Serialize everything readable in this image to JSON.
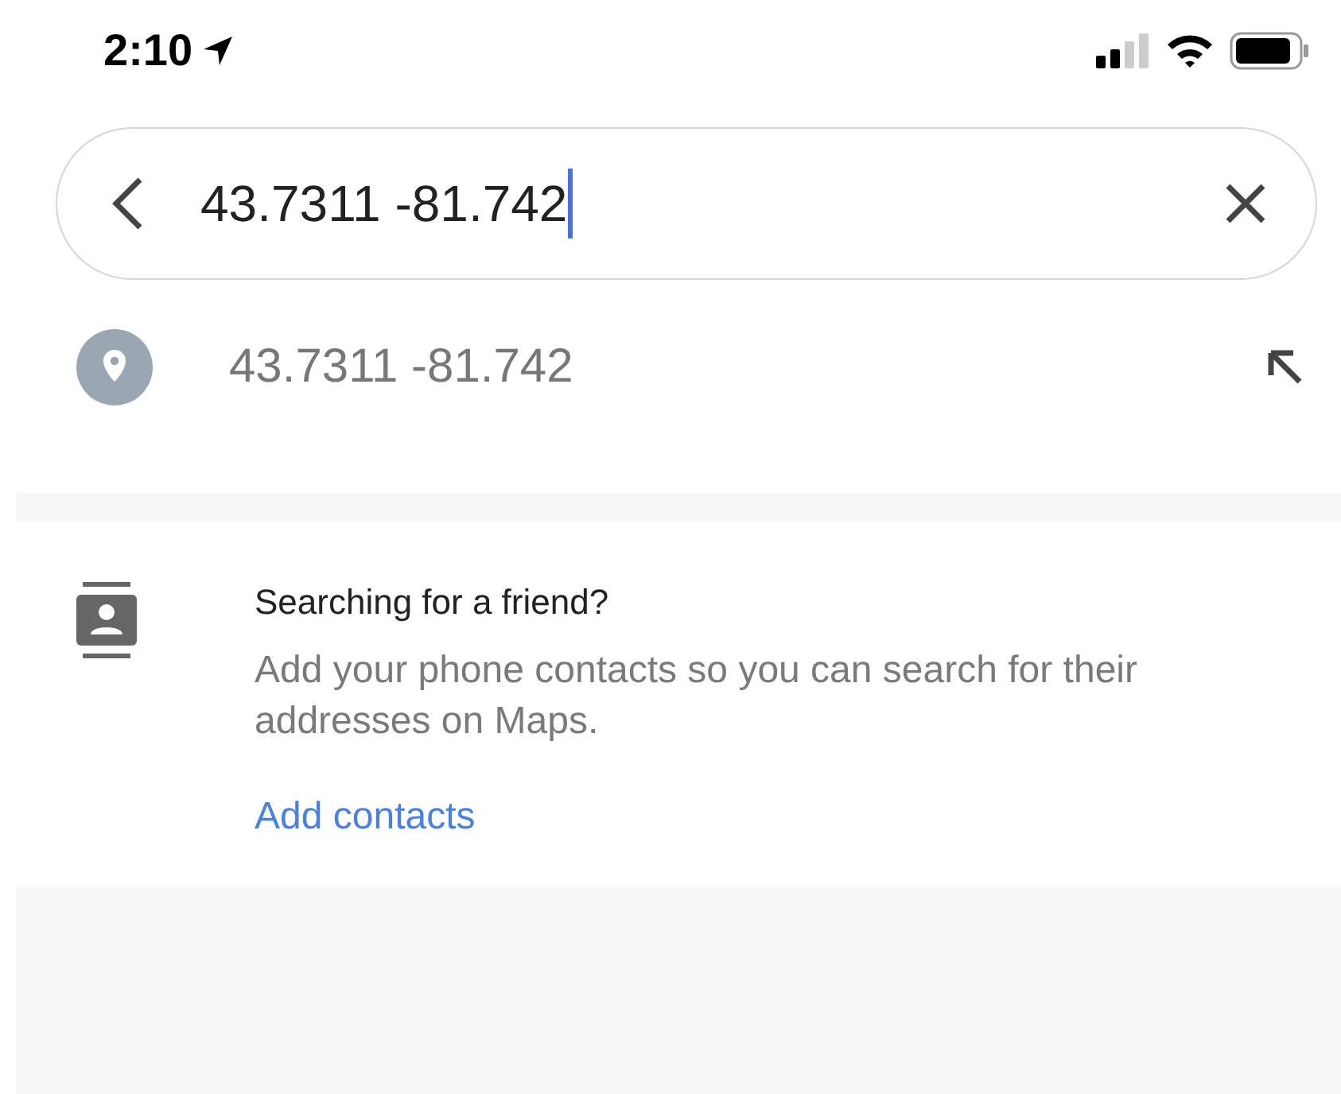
{
  "status_bar": {
    "time": "2:10"
  },
  "search": {
    "value": "43.7311 -81.742"
  },
  "suggestions": [
    {
      "text": "43.7311 -81.742"
    }
  ],
  "contacts_card": {
    "title": "Searching for a friend?",
    "body": "Add your phone contacts so you can search for their addresses on Maps.",
    "link": "Add contacts"
  }
}
